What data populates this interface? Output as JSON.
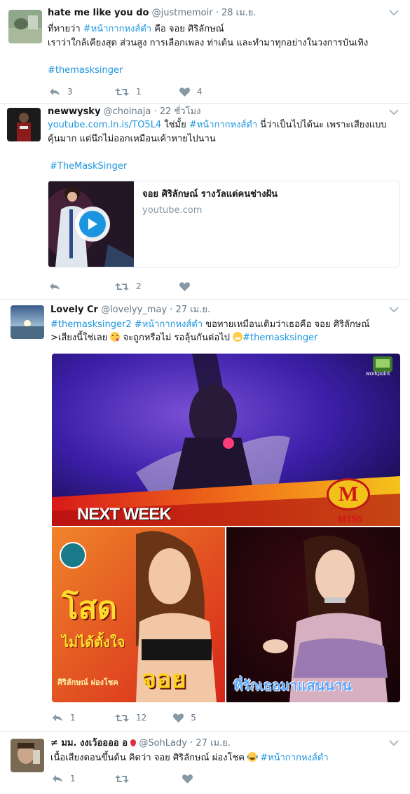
{
  "tweets": [
    {
      "name": "hate me like you do",
      "handle": "@justmemoir",
      "time": "28 เม.ย.",
      "line1": {
        "pre": "ที่ทายว่า ",
        "tag": "#หน้ากากหงส์ดำ",
        "post": " คือ จอย ศิริลักษณ์"
      },
      "line2": "เราว่าใกล้เคียงสุด ส่วนสูง การเลือกเพลง ท่าเต้น และทำมาทุกอย่างในวงการบันเทิง",
      "hashtag_line": "#themasksinger",
      "reply_count": "3",
      "retweet_count": "1",
      "like_count": "4"
    },
    {
      "name": "newwysky",
      "handle": "@choinaja",
      "time": "22 ชั่วโมง",
      "line1": {
        "link": "youtube.com.ln.is/TO5L4",
        "pre": " ใช่มั้ย ",
        "tag": "#หน้ากากหงส์ดำ",
        "post": " นี่ว่าเป็นไปได้นะ เพราะเสียงแบบ"
      },
      "line2": "คุ้นมาก แต่นึกไม่ออกเหมือนเค้าหายไปนาน",
      "hashtag_line": "#TheMaskSinger",
      "card_title": "จอย ศิริลักษณ์ รางวัลแด่คนช่างฝัน",
      "card_domain": "youtube.com",
      "reply_count": "",
      "retweet_count": "2",
      "like_count": ""
    },
    {
      "name": "Lovely Cr",
      "handle": "@lovelyy_may",
      "time": "27 เม.ย.",
      "line1": {
        "tag1": "#themasksinger2",
        "tag2": "#หน้ากากหงส์ดำ",
        "post": "  ขอทายเหมือนเดิมว่าเธอคือ จอย ศิริลักษณ์"
      },
      "line2": {
        "pre": ">เสียงนี้ใช่เลย ",
        "mid": " จะถูกหรือไม่ รอลุ้นกันต่อไป ",
        "tag": "#themasksinger"
      },
      "media_top_text": "NEXT WEEK",
      "media_logo": "workpoint",
      "media_badge": "M",
      "media_badge_sub": "M150",
      "media_left_title": "โสด",
      "media_left_sub": "ไม่ได้ตั้งใจ",
      "media_left_artist": "ศิริลักษณ์ ผ่องโชค",
      "media_left_name": "จอย",
      "media_right_caption": "ที่รักเธอมาแสนนาน",
      "reply_count": "1",
      "retweet_count": "12",
      "like_count": "5"
    },
    {
      "name": "≠ มม. งงเว้ออออ อ",
      "handle": "@SohLady",
      "time": "27 เม.ย.",
      "line1": {
        "pre": "เนื้อเสียงตอนขึ้นต้น คิดว่า จอย ศิริลักษณ์ ผ่องโชค ",
        "tag": "#หน้ากากหงส์ดำ"
      },
      "reply_count": "1",
      "retweet_count": "",
      "like_count": ""
    }
  ],
  "colors": {
    "link": "#1b95e0",
    "meta": "#657786",
    "text": "#14171a",
    "border": "#e6ecf0"
  }
}
